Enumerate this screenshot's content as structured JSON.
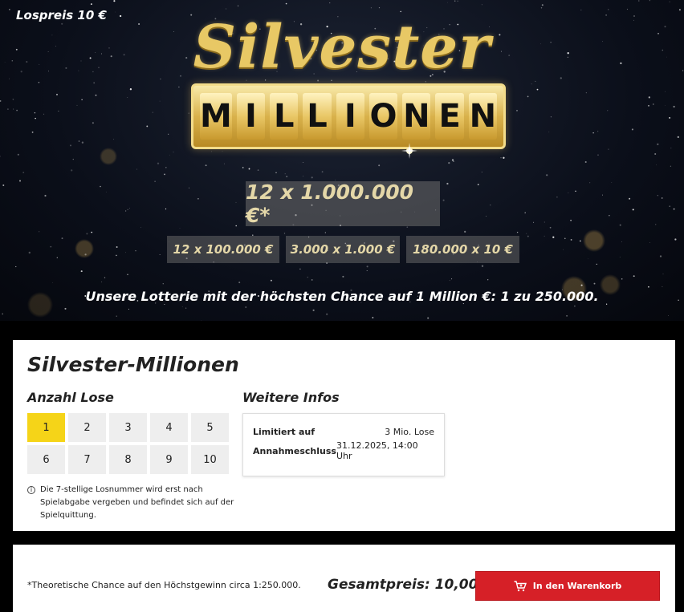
{
  "hero": {
    "price_label": "Lospreis 10 €",
    "logo_script": "Silvester",
    "logo_block": [
      "M",
      "I",
      "L",
      "L",
      "I",
      "O",
      "N",
      "E",
      "N"
    ],
    "main_prize": "12 x 1.000.000 €*",
    "sub_prizes": [
      "12 x 100.000 €",
      "3.000 x 1.000 €",
      "180.000 x 10 €"
    ],
    "tagline": "Unsere Lotterie mit der höchsten Chance auf 1 Million €: 1 zu 250.000."
  },
  "product": {
    "title": "Silvester-Millionen",
    "quantity_heading": "Anzahl Lose",
    "quantities": [
      "1",
      "2",
      "3",
      "4",
      "5",
      "6",
      "7",
      "8",
      "9",
      "10"
    ],
    "selected_quantity": "1",
    "hint_icon": "info-icon",
    "hint": "Die 7-stellige Losnummer wird erst nach Spielabgabe vergeben und befindet sich auf der Spielquittung.",
    "info_heading": "Weitere Infos",
    "info": {
      "limit_label": "Limitiert auf",
      "limit_value": "3 Mio. Lose",
      "deadline_label": "Annahmeschluss",
      "deadline_value": "31.12.2025, 14:00 Uhr"
    }
  },
  "checkout": {
    "footnote": "*Theoretische Chance auf den Höchstgewinn circa 1:250.000.",
    "total": "Gesamtpreis: 10,00 €",
    "cart_button": "In den Warenkorb",
    "cart_icon": "cart-icon"
  },
  "colors": {
    "accent_yellow": "#f5d418",
    "cta_red": "#d62027",
    "gold": "#e4d7a8"
  }
}
